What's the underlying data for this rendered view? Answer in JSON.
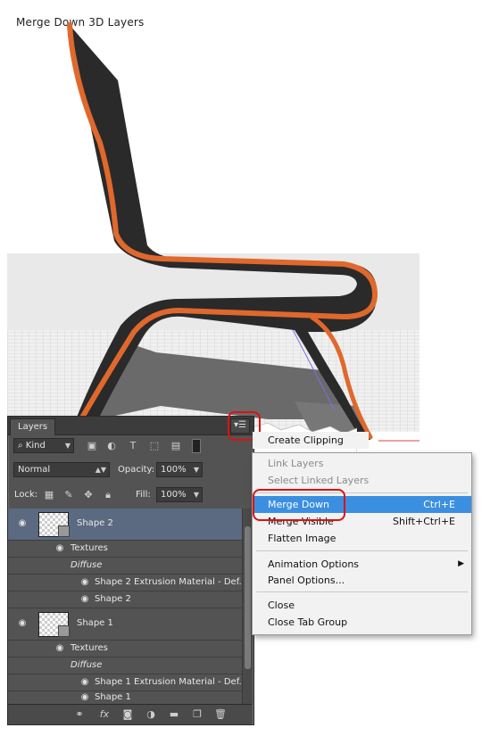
{
  "caption": "Merge Down 3D Layers",
  "panel": {
    "tab": "Layers",
    "filter": {
      "icon": "search-icon",
      "value": "Kind"
    },
    "blend_mode": "Normal",
    "opacity_label": "Opacity:",
    "opacity_value": "100%",
    "lock_label": "Lock:",
    "fill_label": "Fill:",
    "fill_value": "100%",
    "layers": [
      {
        "name": "Shape 2",
        "sub": [
          "Textures",
          "Diffuse",
          "Shape 2 Extrusion Material - Def...",
          "Shape 2"
        ]
      },
      {
        "name": "Shape 1",
        "sub": [
          "Textures",
          "Diffuse",
          "Shape 1 Extrusion Material - Def...",
          "Shape 1"
        ]
      }
    ]
  },
  "menu": {
    "items": [
      {
        "label": "Create Clipping",
        "key": ""
      },
      {
        "label": "Link Layers",
        "key": ""
      },
      {
        "label": "Select Linked Layers",
        "key": ""
      },
      {
        "label": "Merge Down",
        "key": "Ctrl+E"
      },
      {
        "label": "Merge Visible",
        "key": "Shift+Ctrl+E"
      },
      {
        "label": "Flatten Image",
        "key": ""
      },
      {
        "label": "Animation Options",
        "key": ""
      },
      {
        "label": "Panel Options...",
        "key": ""
      },
      {
        "label": "Close",
        "key": ""
      },
      {
        "label": "Close Tab Group",
        "key": ""
      }
    ]
  },
  "colors": {
    "accent": "#3b8fe0",
    "highlight_ring": "#e01010",
    "chair_edge": "#e0682c",
    "chair_body": "#222222"
  }
}
